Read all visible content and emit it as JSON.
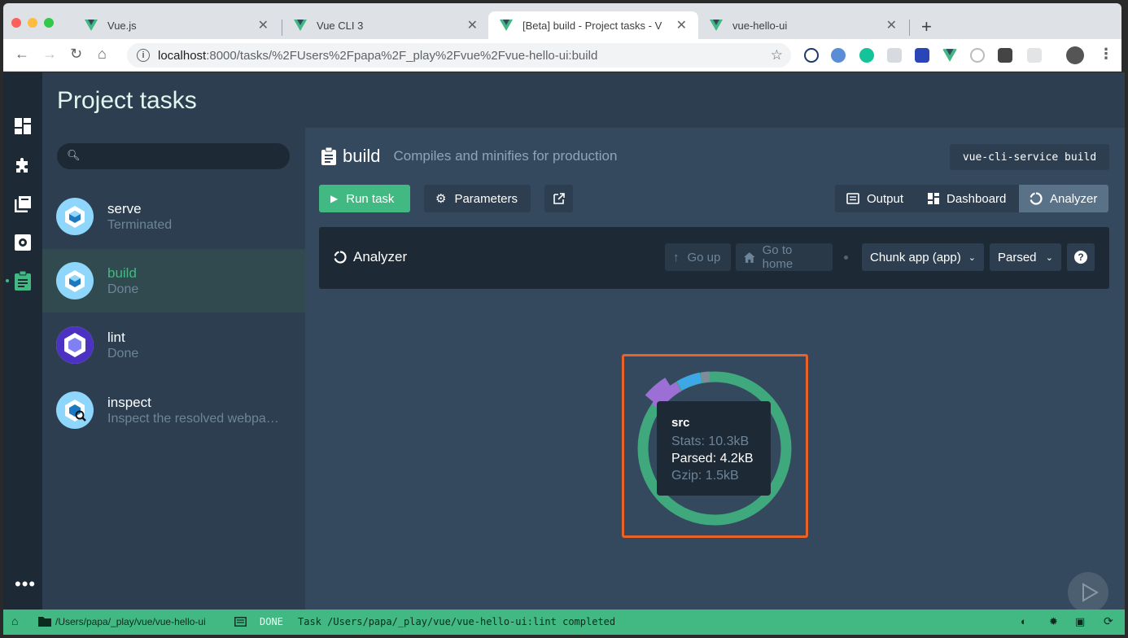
{
  "browser": {
    "tabs": [
      {
        "label": "Vue.js"
      },
      {
        "label": "Vue CLI 3"
      },
      {
        "label": "[Beta] build - Project tasks - V"
      },
      {
        "label": "vue-hello-ui"
      }
    ],
    "close_glyph": "✕",
    "new_tab_glyph": "+",
    "url_host": "localhost",
    "url_rest": ":8000/tasks/%2FUsers%2Fpapa%2F_play%2Fvue%2Fvue-hello-ui:build"
  },
  "app": {
    "header_title": "Project tasks",
    "search_placeholder": "",
    "tasks": [
      {
        "name": "serve",
        "description": "Terminated",
        "icon": "webpack-icon"
      },
      {
        "name": "build",
        "description": "Done",
        "icon": "webpack-icon"
      },
      {
        "name": "lint",
        "description": "Done",
        "icon": "eslint-icon"
      },
      {
        "name": "inspect",
        "description": "Inspect the resolved webpa…",
        "icon": "webpack-inspect-icon"
      }
    ],
    "current_task": {
      "name": "build",
      "description": "Compiles and minifies for production",
      "command": "vue-cli-service build"
    },
    "buttons": {
      "run": "Run task",
      "parameters": "Parameters"
    },
    "view_tabs": [
      "Output",
      "Dashboard",
      "Analyzer"
    ],
    "analyzer": {
      "title": "Analyzer",
      "go_up": "Go up",
      "go_home": "Go to home",
      "chunk_select": "Chunk app (app)",
      "size_select": "Parsed",
      "help": "?"
    },
    "tooltip": {
      "name": "src",
      "stats": "Stats: 10.3kB",
      "parsed": "Parsed: 4.2kB",
      "gzip": "Gzip: 1.5kB"
    }
  },
  "statusbar": {
    "path": "/Users/papa/_play/vue/vue-hello-ui",
    "status": "DONE",
    "message": "Task /Users/papa/_play/vue/vue-hello-ui:lint completed"
  },
  "colors": {
    "accent": "#42b983",
    "purple": "#9b6fd4",
    "blue": "#3ea8e6",
    "highlight": "#e8622a"
  }
}
